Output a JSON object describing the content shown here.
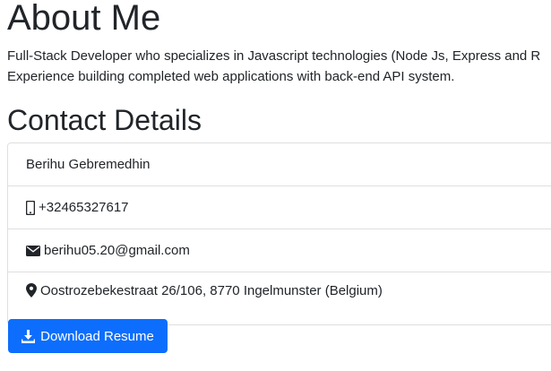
{
  "about": {
    "heading": "About Me",
    "line1": "Full-Stack Developer who specializes in Javascript technologies (Node Js, Express and R",
    "line2": "Experience building completed web applications with back-end API system."
  },
  "contact": {
    "heading": "Contact Details",
    "name": "Berihu Gebremedhin",
    "phone": "+32465327617",
    "email": "berihu05.20@gmail.com",
    "address": "Oostrozebekestraat 26/106, 8770 Ingelmunster (Belgium)"
  },
  "resume_button": {
    "label": "Download Resume"
  },
  "icons": {
    "phone": "mobile-phone-icon",
    "email": "envelope-icon",
    "address": "map-marker-icon",
    "download": "download-icon"
  },
  "colors": {
    "primary": "#0d6efd",
    "text": "#212529"
  }
}
